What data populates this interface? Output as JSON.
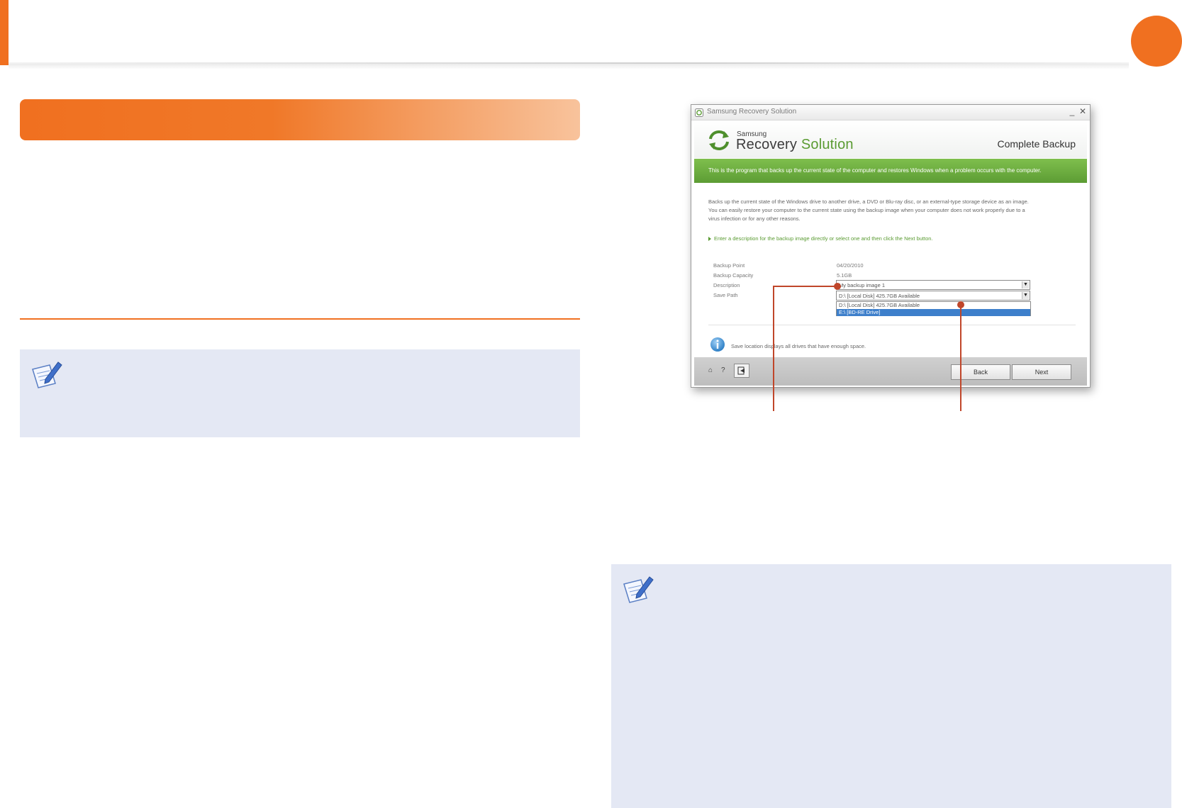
{
  "colors": {
    "accent": "#f07020",
    "note_bg": "#e4e8f4",
    "callout": "#c0462a",
    "app_green": "#5a9b32",
    "selection_blue": "#3d7fcb"
  },
  "window": {
    "title": "Samsung Recovery Solution",
    "min_icon": "minimize-icon",
    "close_icon": "close-icon",
    "min_glyph": "_",
    "close_glyph": "✕"
  },
  "app_header": {
    "logo_small": "Samsung",
    "logo_word1": "Recovery",
    "logo_word2": "Solution",
    "mode": "Complete Backup"
  },
  "banner_text": "This is the program that backs up the current state of the computer and restores Windows when a problem occurs with the computer.",
  "description_lines": [
    "Backs up the current state of the Windows drive to another drive, a DVD or Blu-ray disc, or an external-type storage device as an image.",
    "You can easily restore your computer to the current state using the backup image when your computer does not work properly due to a",
    "virus infection or for any other reasons."
  ],
  "instruction": "Enter a description for the backup image directly or select one and then click the Next button.",
  "fields": {
    "backup_point_label": "Backup Point",
    "backup_point_value": "04/20/2010",
    "backup_capacity_label": "Backup Capacity",
    "backup_capacity_value": "5.1GB",
    "description_label": "Description",
    "description_value": "My backup image 1",
    "save_path_label": "Save Path",
    "save_path_value": "D:\\ [Local Disk] 425.7GB Available"
  },
  "save_path_options": [
    "D:\\ [Local Disk] 425.7GB Available",
    "E:\\ [BD-RE Drive]"
  ],
  "info_text": "Save location displays all drives that have enough space.",
  "footer": {
    "home_glyph": "⌂",
    "help_glyph": "?",
    "back_label": "Back",
    "next_label": "Next"
  }
}
